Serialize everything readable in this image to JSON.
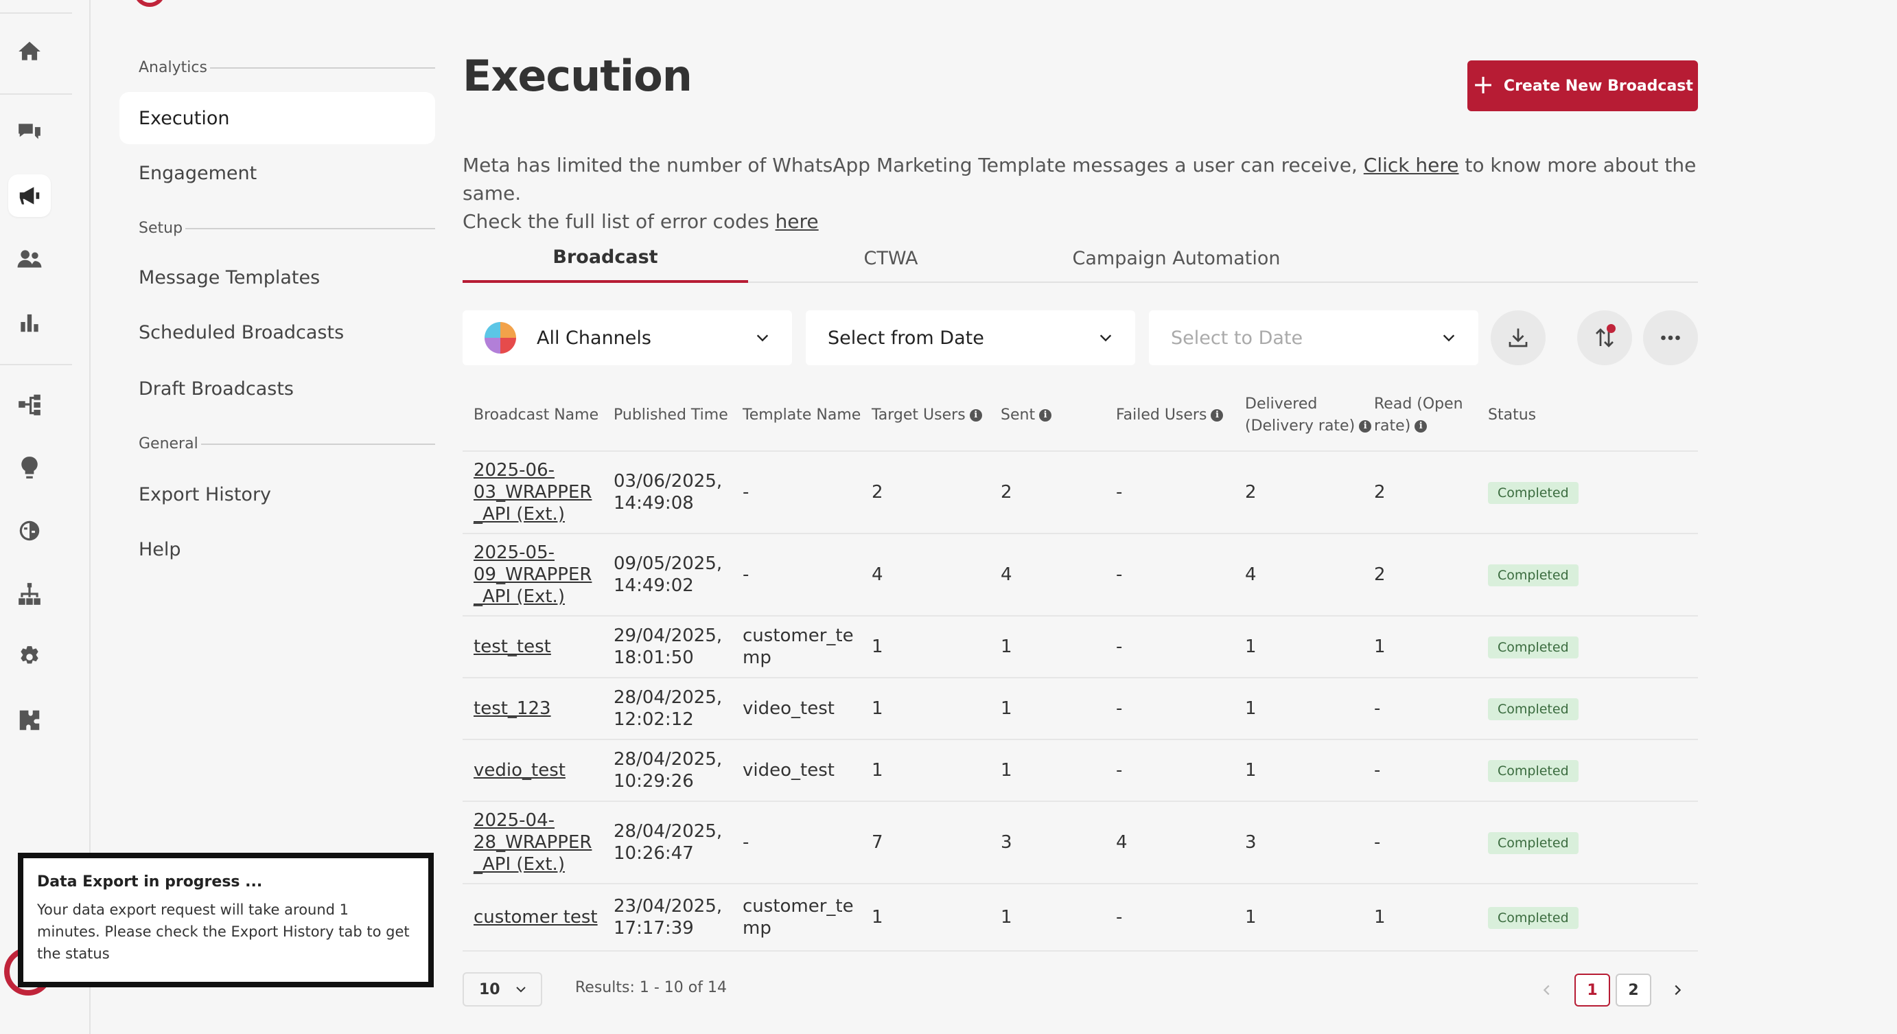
{
  "colors": {
    "accent": "#b71c34",
    "badge_bg": "#d9efdb",
    "badge_text": "#3a6b3e"
  },
  "rail": {
    "icons": [
      "home-icon",
      "chat-icon",
      "megaphone-icon",
      "users-icon",
      "bar-chart-icon",
      "flow-icon",
      "bulb-icon",
      "brain-icon",
      "hierarchy-icon",
      "gear-icon",
      "puzzle-icon"
    ],
    "active": "megaphone-icon"
  },
  "subnav": {
    "sections": [
      {
        "heading": "Analytics",
        "items": [
          "Execution",
          "Engagement"
        ]
      },
      {
        "heading": "Setup",
        "items": [
          "Message Templates",
          "Scheduled Broadcasts",
          "Draft Broadcasts"
        ]
      },
      {
        "heading": "General",
        "items": [
          "Export History",
          "Help"
        ]
      }
    ],
    "active_item": "Execution"
  },
  "header": {
    "title": "Execution",
    "create_button": "Create New Broadcast",
    "create_plus": "+"
  },
  "notice": {
    "text1": "Meta has limited the number of WhatsApp Marketing Template messages a user can receive, ",
    "link1": "Click here",
    "text2": " to know more about the same.",
    "text3": "Check the full list of error codes ",
    "link2": "here"
  },
  "tabs": [
    "Broadcast",
    "CTWA",
    "Campaign Automation"
  ],
  "active_tab": "Broadcast",
  "filters": {
    "channel": "All Channels",
    "from_date": "Select from Date",
    "to_date_placeholder": "Select to Date"
  },
  "table": {
    "columns": [
      {
        "label": "Broadcast Name",
        "info": false
      },
      {
        "label": "Published Time",
        "info": false
      },
      {
        "label": "Template Name",
        "info": false
      },
      {
        "label": "Target Users",
        "info": true
      },
      {
        "label": "Sent",
        "info": true
      },
      {
        "label": "Failed Users",
        "info": true
      },
      {
        "label": "Delivered (Delivery rate)",
        "info": true
      },
      {
        "label": "Read (Open rate)",
        "info": true
      },
      {
        "label": "Status",
        "info": false
      }
    ],
    "info_glyph": "i",
    "rows": [
      {
        "name": [
          "2025-06-",
          "03_WRAPPER",
          "_API (Ext.)"
        ],
        "published": [
          "03/06/2025,",
          "14:49:08"
        ],
        "template": [
          "-"
        ],
        "target": "2",
        "sent": "2",
        "failed": "-",
        "delivered": "2",
        "read": "2",
        "status": "Completed"
      },
      {
        "name": [
          "2025-05-",
          "09_WRAPPER",
          "_API (Ext.)"
        ],
        "published": [
          "09/05/2025,",
          "14:49:02"
        ],
        "template": [
          "-"
        ],
        "target": "4",
        "sent": "4",
        "failed": "-",
        "delivered": "4",
        "read": "2",
        "status": "Completed"
      },
      {
        "name": [
          "test_test"
        ],
        "published": [
          "29/04/2025,",
          "18:01:50"
        ],
        "template": [
          "customer_te",
          "mp"
        ],
        "target": "1",
        "sent": "1",
        "failed": "-",
        "delivered": "1",
        "read": "1",
        "status": "Completed"
      },
      {
        "name": [
          "test_123"
        ],
        "published": [
          "28/04/2025,",
          "12:02:12"
        ],
        "template": [
          "video_test"
        ],
        "target": "1",
        "sent": "1",
        "failed": "-",
        "delivered": "1",
        "read": "-",
        "status": "Completed"
      },
      {
        "name": [
          "vedio_test"
        ],
        "published": [
          "28/04/2025,",
          "10:29:26"
        ],
        "template": [
          "video_test"
        ],
        "target": "1",
        "sent": "1",
        "failed": "-",
        "delivered": "1",
        "read": "-",
        "status": "Completed"
      },
      {
        "name": [
          "2025-04-",
          "28_WRAPPER",
          "_API (Ext.)"
        ],
        "published": [
          "28/04/2025,",
          "10:26:47"
        ],
        "template": [
          "-"
        ],
        "target": "7",
        "sent": "3",
        "failed": "4",
        "delivered": "3",
        "read": "-",
        "status": "Completed"
      },
      {
        "name": [
          "customer test"
        ],
        "published": [
          "23/04/2025,",
          "17:17:39"
        ],
        "template": [
          "customer_te",
          "mp"
        ],
        "target": "1",
        "sent": "1",
        "failed": "-",
        "delivered": "1",
        "read": "1",
        "status": "Completed"
      }
    ]
  },
  "pagination": {
    "rows_per_page": "10",
    "results": "Results: 1 - 10 of 14",
    "pages": [
      "1",
      "2"
    ],
    "current_page": "1"
  },
  "toast": {
    "title": "Data Export in progress ...",
    "body": "Your data export request will take around 1 minutes. Please check the Export History tab to get the status"
  }
}
